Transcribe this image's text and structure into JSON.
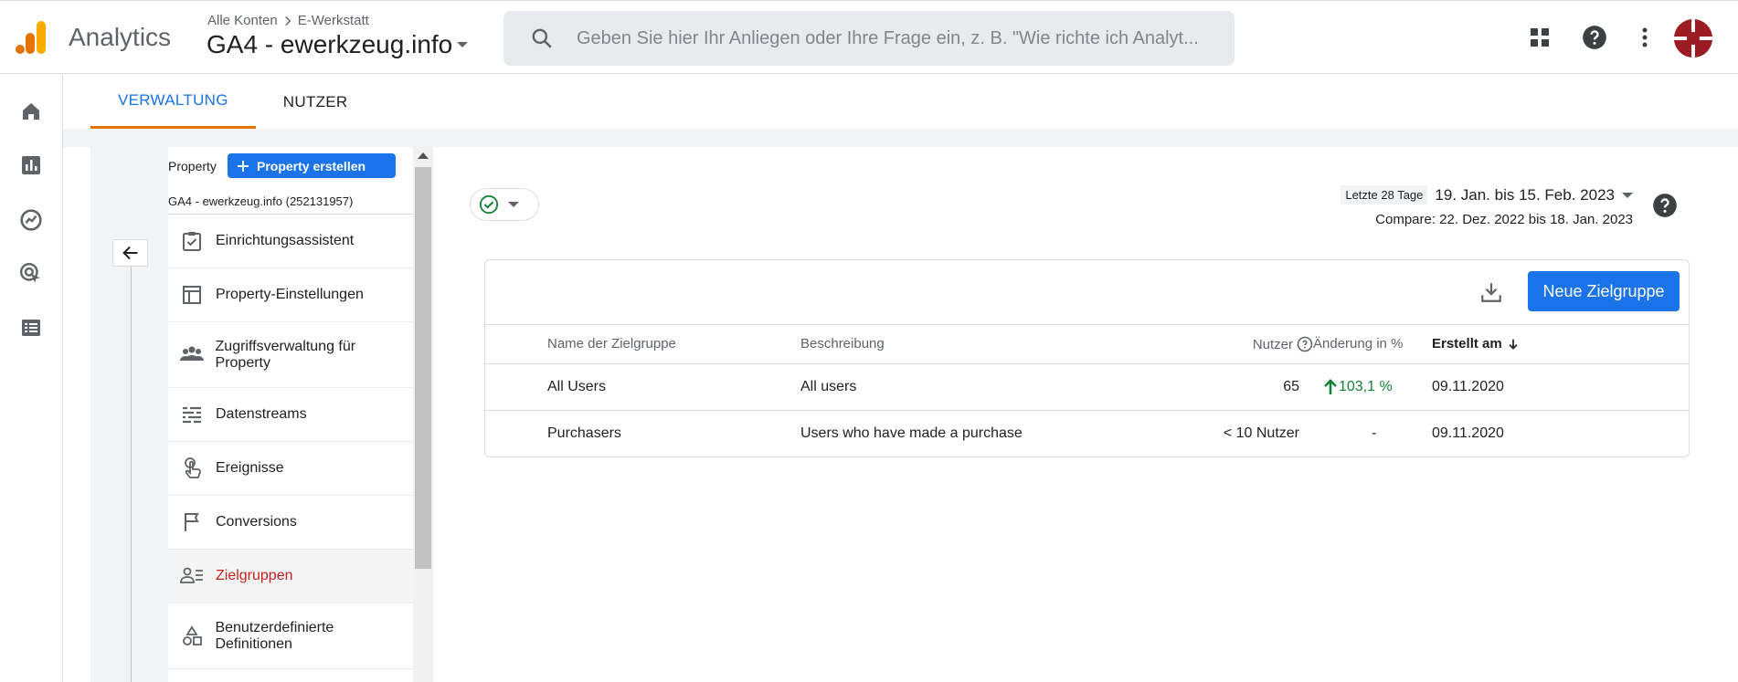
{
  "header": {
    "app_name": "Analytics",
    "breadcrumb": {
      "root": "Alle Konten",
      "account": "E-Werkstatt"
    },
    "property": "GA4 - ewerkzeug.info",
    "search_placeholder": "Geben Sie hier Ihr Anliegen oder Ihre Frage ein, z. B. \"Wie richte ich Analyt...",
    "icons": [
      "apps-icon",
      "help-icon",
      "more-vert-icon"
    ],
    "logo_colors": [
      "#f9ab00",
      "#e37400"
    ]
  },
  "rail": {
    "items": [
      "home-icon",
      "reports-icon",
      "explore-icon",
      "advertising-icon",
      "configure-icon"
    ]
  },
  "tabs": [
    {
      "label": "VERWALTUNG",
      "active": true
    },
    {
      "label": "NUTZER",
      "active": false
    }
  ],
  "admin": {
    "property_label": "Property",
    "create_label": "Property erstellen",
    "property_name": "GA4 - ewerkzeug.info (252131957)",
    "items": [
      {
        "label": "Einrichtungsassistent",
        "icon": "checklist-icon"
      },
      {
        "label": "Property-Einstellungen",
        "icon": "layout-icon"
      },
      {
        "label": "Zugriffsverwaltung für Property",
        "icon": "people-icon"
      },
      {
        "label": "Datenstreams",
        "icon": "streams-icon"
      },
      {
        "label": "Ereignisse",
        "icon": "touch-icon"
      },
      {
        "label": "Conversions",
        "icon": "flag-icon"
      },
      {
        "label": "Zielgruppen",
        "icon": "audience-icon",
        "active": true
      },
      {
        "label": "Benutzerdefinierte Definitionen",
        "icon": "shapes-icon"
      }
    ]
  },
  "date": {
    "period": "Letzte 28 Tage",
    "range": "19. Jan. bis 15. Feb. 2023",
    "compare": "Compare: 22. Dez. 2022 bis 18. Jan. 2023"
  },
  "table": {
    "new_button": "Neue Zielgruppe",
    "columns": {
      "name": "Name der Zielgruppe",
      "description": "Beschreibung",
      "users": "Nutzer",
      "change": "Änderung in %",
      "created": "Erstellt am"
    },
    "rows": [
      {
        "name": "All Users",
        "description": "All users",
        "users": "65",
        "change": "103,1 %",
        "created": "09.11.2020"
      },
      {
        "name": "Purchasers",
        "description": "Users who have made a purchase",
        "users": "< 10 Nutzer",
        "change": "-",
        "created": "09.11.2020"
      }
    ],
    "colors": {
      "positive": "#188038",
      "primary": "#1a73e8",
      "active_nav": "#c5221f"
    }
  }
}
